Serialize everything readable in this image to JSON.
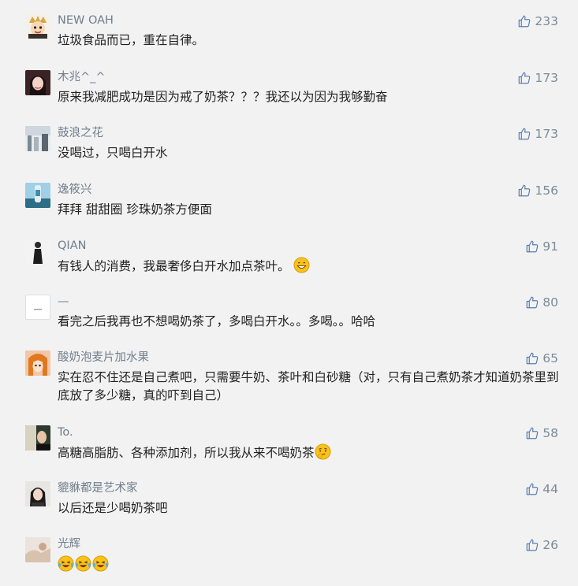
{
  "comments": [
    {
      "name": "NEW OAH",
      "content": "垃圾食品而已，重在自律。",
      "likes": "233"
    },
    {
      "name": "木兆^_^",
      "content": "原来我减肥成功是因为戒了奶茶？？？我还以为因为我够勤奋",
      "likes": "173"
    },
    {
      "name": "鼓浪之花",
      "content": "没喝过，只喝白开水",
      "likes": "173"
    },
    {
      "name": "逸筱兴",
      "content": "拜拜  甜甜圈 珍珠奶茶方便面",
      "likes": "156"
    },
    {
      "name": "QIAN",
      "content": "有钱人的消费，我最奢侈白开水加点茶叶。",
      "likes": "91",
      "emoji": "grin-emoji"
    },
    {
      "name": "—",
      "content": "看完之后我再也不想喝奶茶了，多喝白开水。。多喝。。哈哈",
      "likes": "80"
    },
    {
      "name": "酸奶泡麦片加水果",
      "content": "实在忍不住还是自己煮吧，只需要牛奶、茶叶和白砂糖（对，只有自己煮奶茶才知道奶茶里到底放了多少糖，真的吓到自己）",
      "likes": "65"
    },
    {
      "name": "To.",
      "content": "高糖高脂肪、各种添加剂，所以我从来不喝奶茶",
      "likes": "58",
      "emoji": "thinking-emoji"
    },
    {
      "name": "貔貅都是艺术家",
      "content": "以后还是少喝奶茶吧",
      "likes": "44"
    },
    {
      "name": "光辉",
      "content": "",
      "likes": "26",
      "emoji": "laughing-crying-emoji x3"
    }
  ],
  "colors": {
    "background": "#f2f2f2",
    "name": "#707e8c",
    "content": "#222222",
    "like": "#7d8b99"
  },
  "icons": {
    "like": "thumbs-up-icon"
  }
}
